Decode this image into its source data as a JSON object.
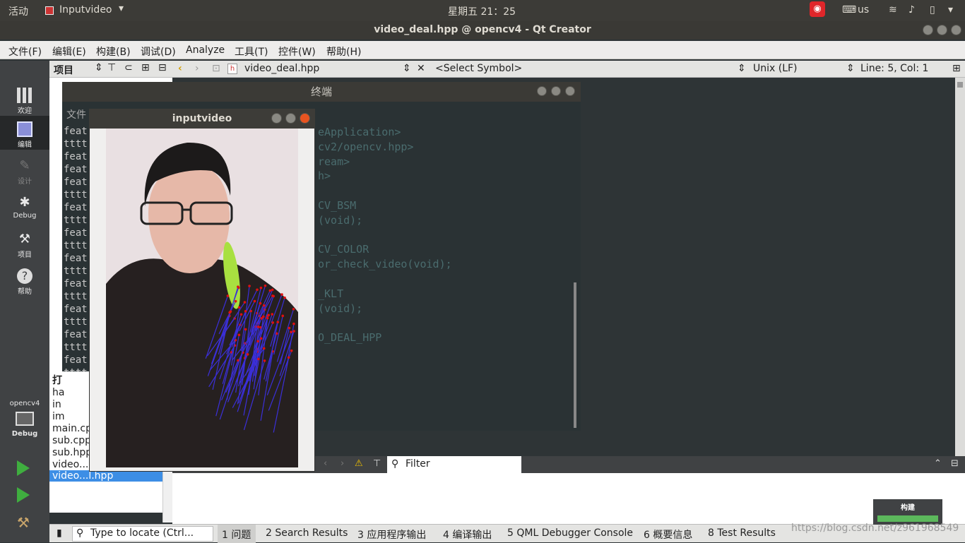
{
  "topbar": {
    "activities": "活动",
    "app": "Inputvideo",
    "clock": "星期五 21：25",
    "kbd": "us"
  },
  "window": {
    "title": "video_deal.hpp @ opencv4 - Qt Creator"
  },
  "menu": [
    "文件(F)",
    "编辑(E)",
    "构建(B)",
    "调试(D)",
    "Analyze",
    "工具(T)",
    "控件(W)",
    "帮助(H)"
  ],
  "sidebar": {
    "items": [
      {
        "label": "欢迎",
        "icon": "grid-icon"
      },
      {
        "label": "编辑",
        "icon": "edit-icon"
      },
      {
        "label": "设计",
        "icon": "pen-icon"
      },
      {
        "label": "Debug",
        "icon": "bug-icon"
      },
      {
        "label": "项目",
        "icon": "wrench-icon"
      },
      {
        "label": "帮助",
        "icon": "help-icon"
      }
    ],
    "target": {
      "project": "opencv4",
      "mode": "Debug"
    }
  },
  "project_panel": {
    "header": "项目",
    "open_docs_header": "打",
    "files": [
      "ha",
      "in",
      "im",
      "main.cp",
      "sub.cpp",
      "sub.hpp",
      "video...",
      "video...l.hpp"
    ]
  },
  "editor_bar": {
    "file": "video_deal.hpp",
    "symbol": "<Select Symbol>",
    "line_ending": "Unix (LF)",
    "position": "Line: 5, Col: 1"
  },
  "terminal": {
    "title": "终端",
    "file_label": "文件",
    "lines": [
      "feat",
      "tttt",
      "feat",
      "feat",
      "feat",
      "tttt",
      "feat",
      "tttt",
      "feat",
      "tttt",
      "feat",
      "tttt",
      "feat",
      "tttt",
      "feat",
      "tttt",
      "feat",
      "tttt",
      "feat",
      "tttt",
      "feat",
      "tttt",
      "feat"
    ],
    "code": [
      "eApplication>",
      "cv2/opencv.hpp>",
      "ream>",
      "h>",
      "",
      "CV_BSM",
      "(void);",
      "",
      "CV_COLOR",
      "or_check_video(void);",
      "",
      "_KLT",
      "(void);",
      "",
      "O_DEAL_HPP"
    ]
  },
  "video_window": {
    "title": "inputvideo"
  },
  "issues": {
    "label": "问题",
    "filter": "Filter"
  },
  "statusbar": {
    "locate": "Type to locate (Ctrl...",
    "tabs": [
      "1 问题",
      "2 Search Results",
      "3 应用程序输出",
      "4 编译输出",
      "5 QML Debugger Console",
      "6 概要信息",
      "8 Test Results"
    ]
  },
  "build_badge": "构建",
  "watermark": "https://blog.csdn.net/z961968549",
  "colors": {
    "accent": "#3d8ee5",
    "tracks": "#3b2fd9",
    "points": "#e01010"
  }
}
